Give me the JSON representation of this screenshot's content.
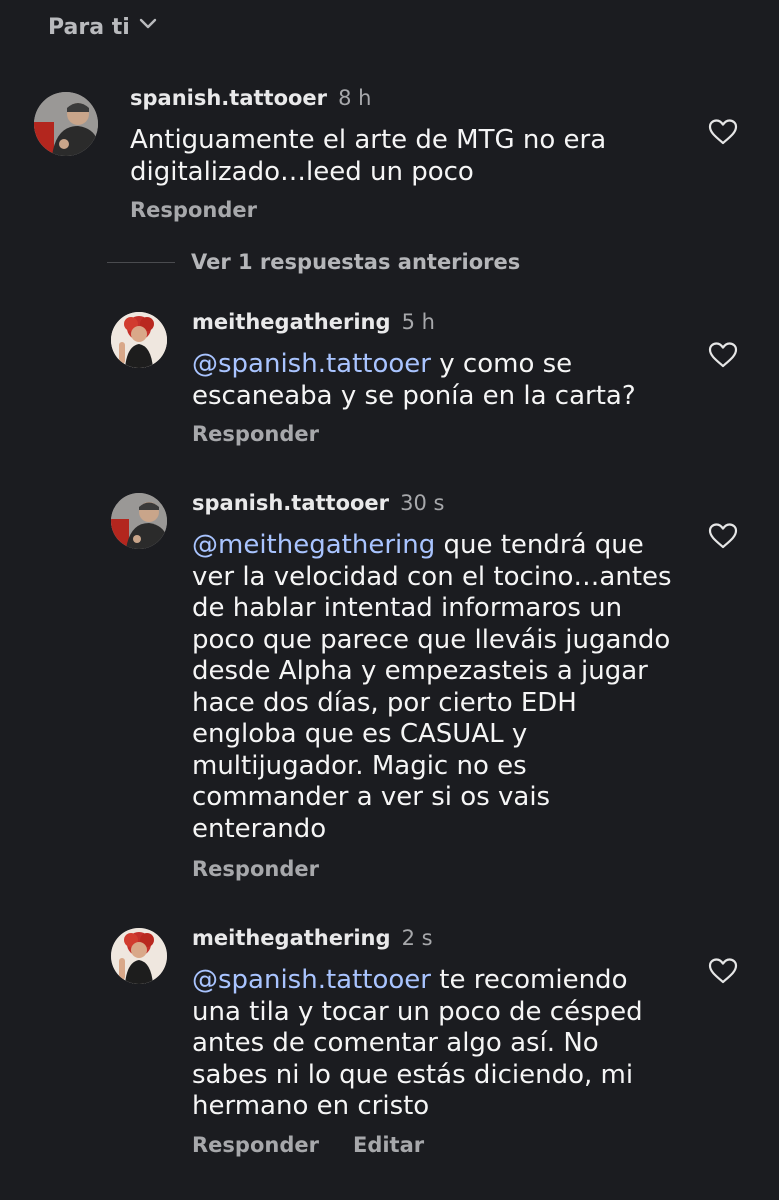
{
  "header": {
    "title": "Para ti",
    "chevron_icon": "chevron-down-icon"
  },
  "view_replies": "Ver 1 respuestas anteriores",
  "comments": [
    {
      "username": "spanish.tattooer",
      "time": "8 h",
      "mention": "",
      "text": "Antiguamente el arte de MTG no era digitalizado…leed un poco",
      "reply": "Responder",
      "edit": ""
    },
    {
      "username": "meithegathering",
      "time": "5 h",
      "mention": "@spanish.tattooer",
      "text": " y como se escaneaba y se ponía en la carta?",
      "reply": "Responder",
      "edit": ""
    },
    {
      "username": "spanish.tattooer",
      "time": "30 s",
      "mention": "@meithegathering",
      "text": " que tendrá que ver la velocidad con el tocino…antes de hablar intentad informaros un poco que parece que lleváis jugando desde Alpha y empezasteis a jugar hace dos días, por cierto EDH engloba que es CASUAL y multijugador. Magic no es commander a ver si os vais enterando",
      "reply": "Responder",
      "edit": ""
    },
    {
      "username": "meithegathering",
      "time": "2 s",
      "mention": "@spanish.tattooer",
      "text": " te recomiendo una tila y tocar un poco de césped antes de comentar algo así. No sabes ni lo que estás diciendo, mi hermano en cristo",
      "reply": "Responder",
      "edit": "Editar"
    }
  ]
}
